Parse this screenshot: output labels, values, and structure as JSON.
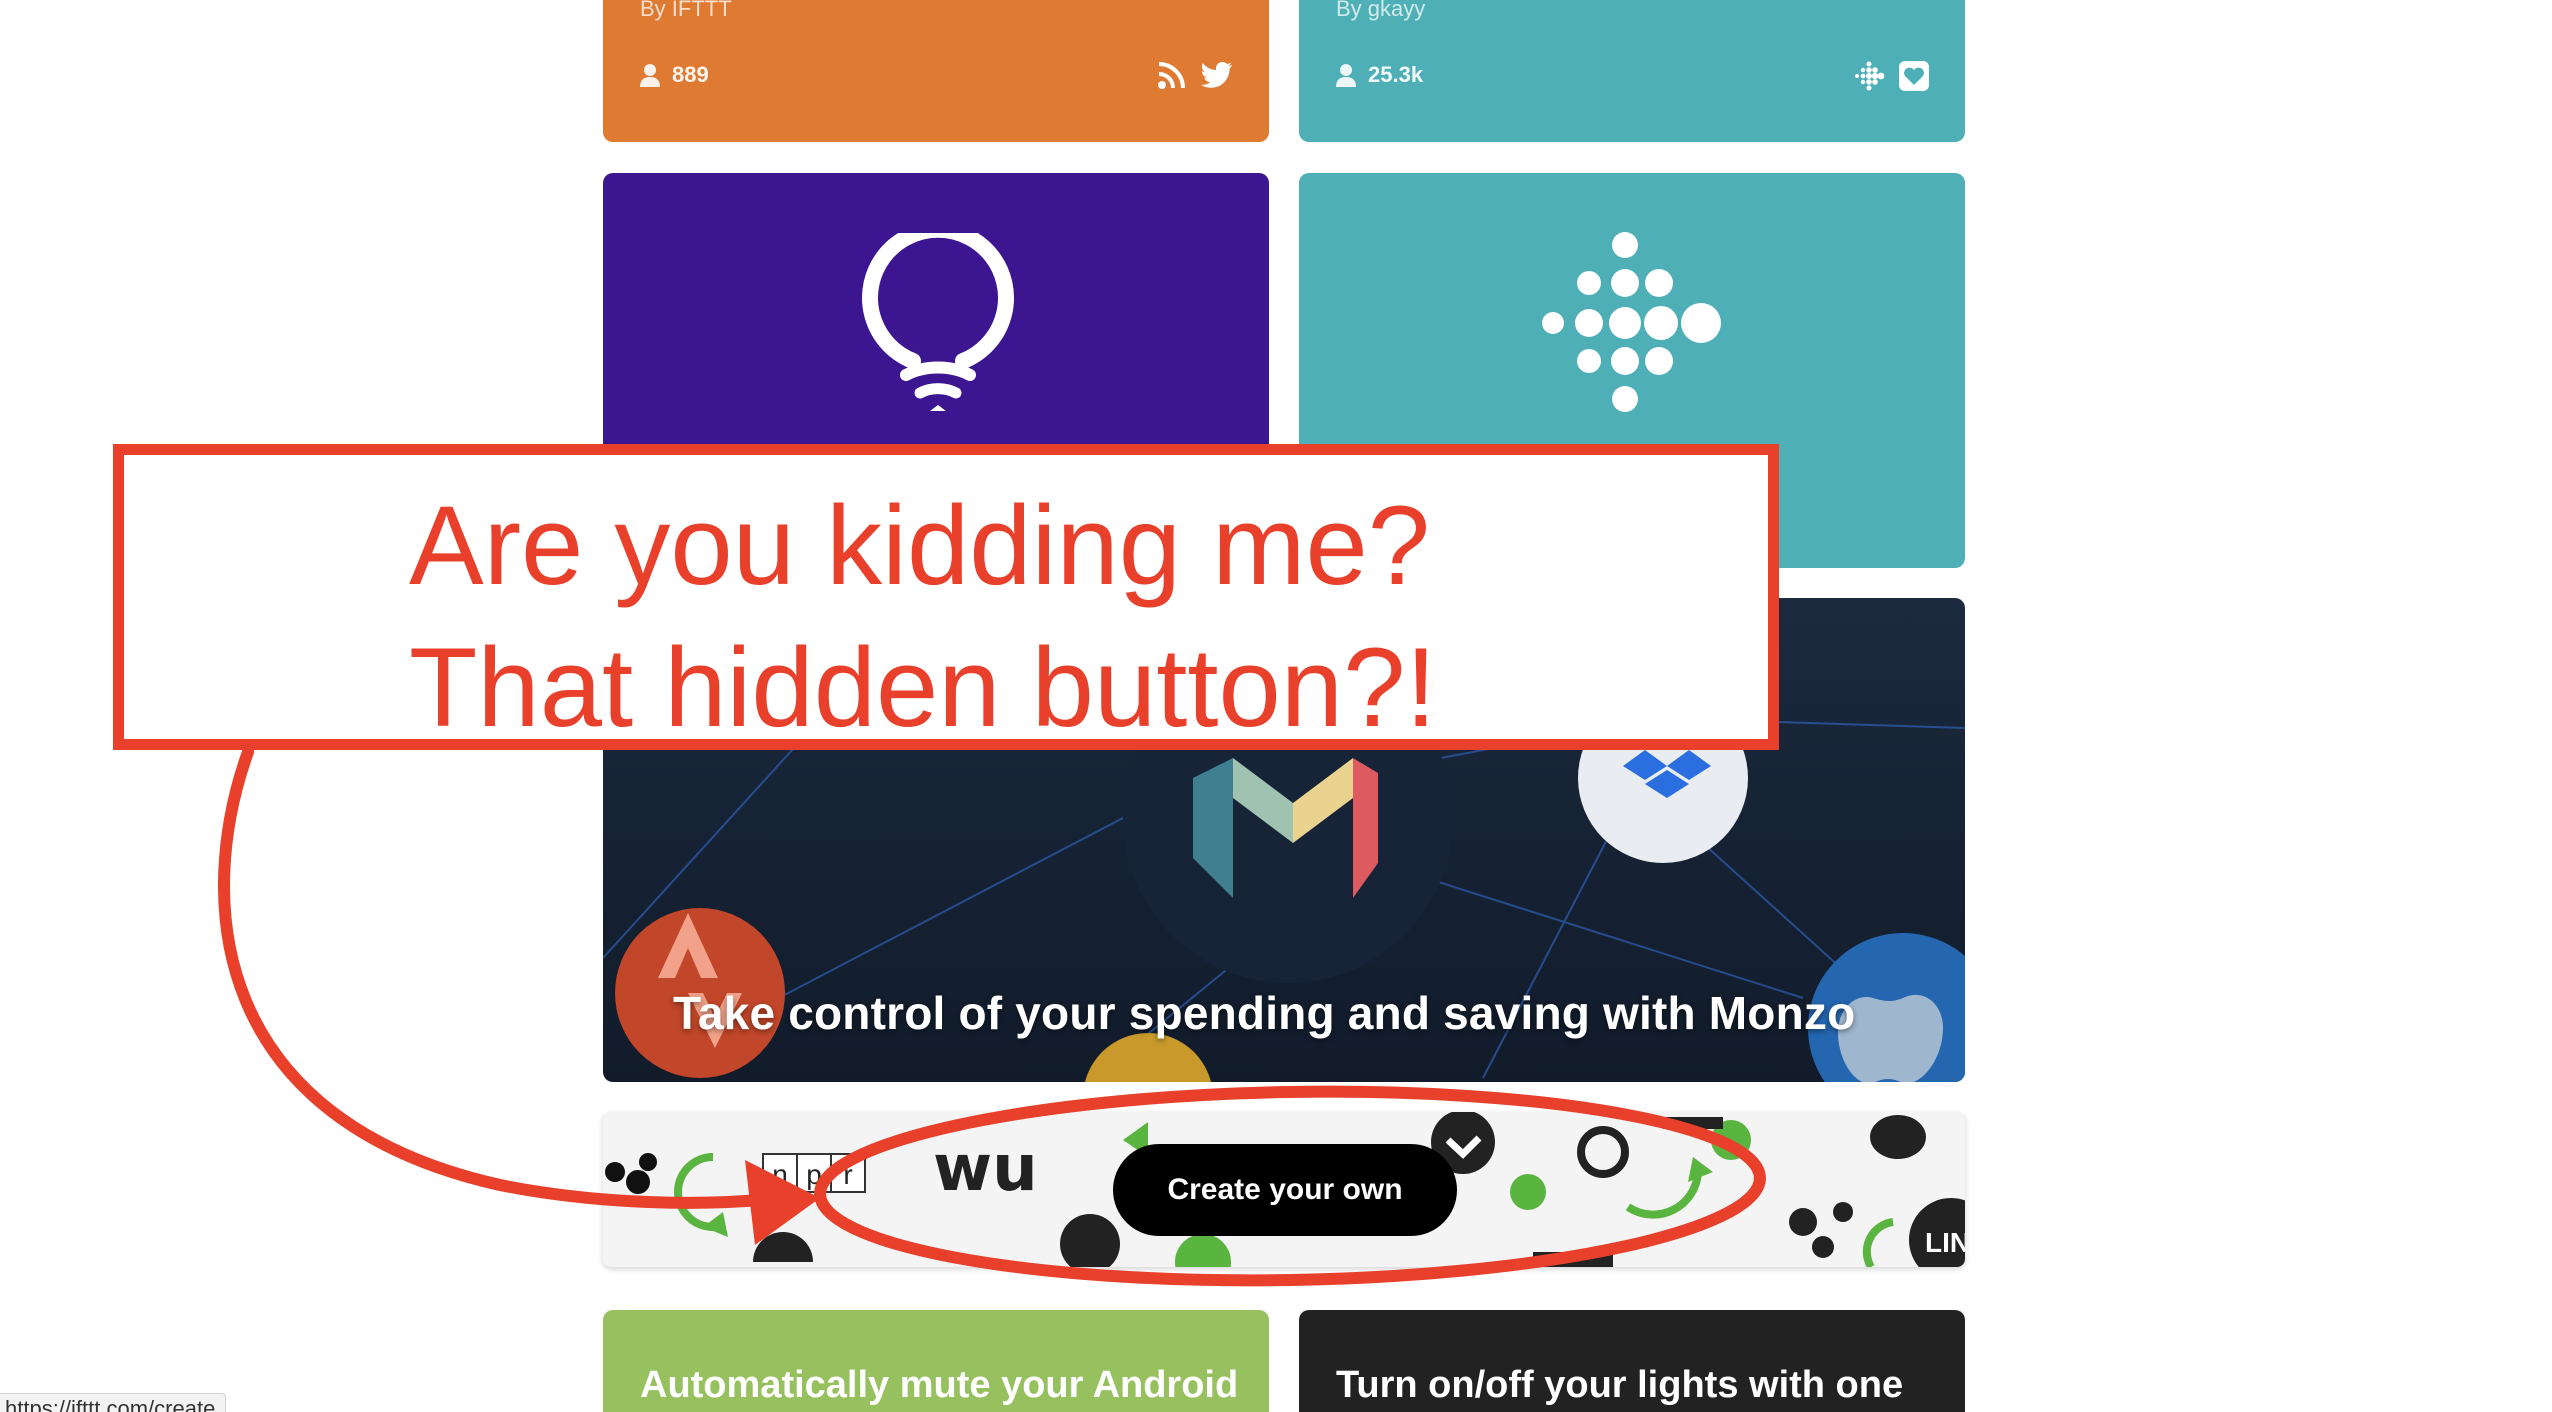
{
  "cards": {
    "orange": {
      "author": "By IFTTT",
      "users": "889",
      "icons": [
        "rss-icon",
        "twitter-icon"
      ],
      "color": "#df7a33"
    },
    "teal": {
      "author": "By gkayy",
      "users": "25.3k",
      "icons": [
        "fitbit-icon",
        "heart-icon"
      ],
      "color": "#4eafb7"
    },
    "lifx": {
      "icon": "lifx-bulb-icon",
      "color": "#3c1590"
    },
    "fitbit": {
      "icon": "fitbit-logo-icon",
      "color": "#4eafb7"
    },
    "monzo": {
      "title": "Take control of your spending and saving with Monzo",
      "icons": [
        "monzo-m-icon",
        "dropbox-icon",
        "strava-icon",
        "apple-icon"
      ]
    },
    "green": {
      "title": "Automatically mute your Android phone at bedtime",
      "color": "#97c15f"
    },
    "dark": {
      "title": "Turn on/off your lights with one tap on your phone",
      "color": "#222222"
    }
  },
  "create": {
    "button_label": "Create your own",
    "logo_texts": [
      "n",
      "p",
      "r",
      "wu",
      "LINE"
    ]
  },
  "annotation": {
    "line1": "Are you kidding me?",
    "line2": "That hidden button?!",
    "color": "#e8402b"
  },
  "status_bar": {
    "url": "https://ifttt.com/create"
  }
}
